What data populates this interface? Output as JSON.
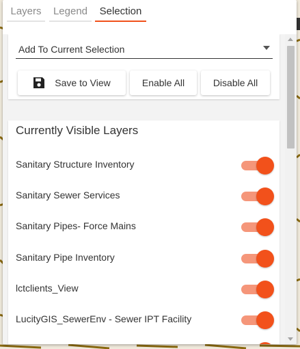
{
  "tabs": [
    {
      "label": "Layers",
      "active": false
    },
    {
      "label": "Legend",
      "active": false
    },
    {
      "label": "Selection",
      "active": true
    }
  ],
  "selection_mode": {
    "value": "Add To Current Selection"
  },
  "buttons": {
    "save_to_view": "Save to View",
    "enable_all": "Enable All",
    "disable_all": "Disable All"
  },
  "layers_section": {
    "title": "Currently Visible Layers",
    "layers": [
      {
        "label": "Sanitary Structure Inventory",
        "enabled": true
      },
      {
        "label": "Sanitary Sewer Services",
        "enabled": true
      },
      {
        "label": "Sanitary Pipes- Force Mains",
        "enabled": true
      },
      {
        "label": "Sanitary Pipe Inventory",
        "enabled": true
      },
      {
        "label": "lctclients_View",
        "enabled": true
      },
      {
        "label": "LucityGIS_SewerEnv - Sewer IPT Facility",
        "enabled": true
      },
      {
        "label": "",
        "enabled": true
      }
    ]
  },
  "colors": {
    "accent": "#f2511b",
    "toggle_track": "#f5967a",
    "map_lines": "#8a6a10"
  },
  "icons": {
    "save": "save-icon",
    "dropdown": "chevron-down-icon"
  }
}
